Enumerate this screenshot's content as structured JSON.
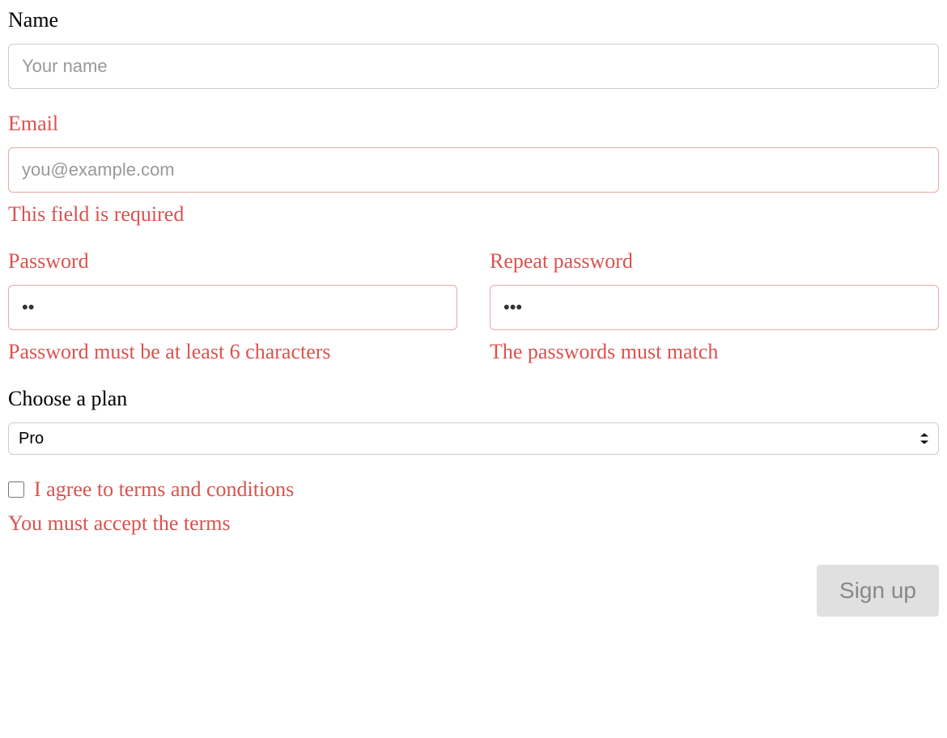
{
  "form": {
    "name": {
      "label": "Name",
      "placeholder": "Your name",
      "value": ""
    },
    "email": {
      "label": "Email",
      "placeholder": "you@example.com",
      "value": "",
      "error": "This field is required"
    },
    "password": {
      "label": "Password",
      "value": "••",
      "error": "Password must be at least 6 characters"
    },
    "repeat_password": {
      "label": "Repeat password",
      "value": "•••",
      "error": "The passwords must match"
    },
    "plan": {
      "label": "Choose a plan",
      "selected": "Pro"
    },
    "terms": {
      "label": "I agree to terms and conditions",
      "checked": false,
      "error": "You must accept the terms"
    },
    "submit": {
      "label": "Sign up"
    }
  }
}
